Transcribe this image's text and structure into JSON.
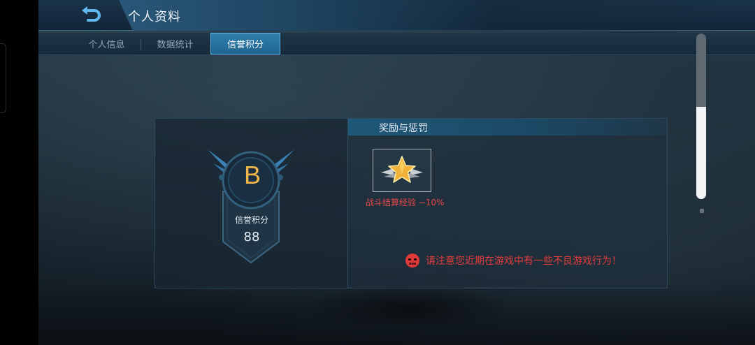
{
  "header": {
    "title": "个人资料"
  },
  "tabs": [
    {
      "label": "个人信息",
      "active": false
    },
    {
      "label": "数据统计",
      "active": false
    },
    {
      "label": "信誉积分",
      "active": true
    }
  ],
  "credit": {
    "grade": "B",
    "label": "信誉积分",
    "score": "88"
  },
  "rewards_panel": {
    "title": "奖励与惩罚",
    "item_label": "战斗结算经验 −10%",
    "item_icon": "gold-star-icon",
    "warning_icon": "angry-face-icon",
    "warning_text": "请注意您近期在游戏中有一些不良游戏行为！"
  },
  "colors": {
    "accent": "#2f7fae",
    "grade": "#f1b64a",
    "warning": "#e33d3d"
  }
}
